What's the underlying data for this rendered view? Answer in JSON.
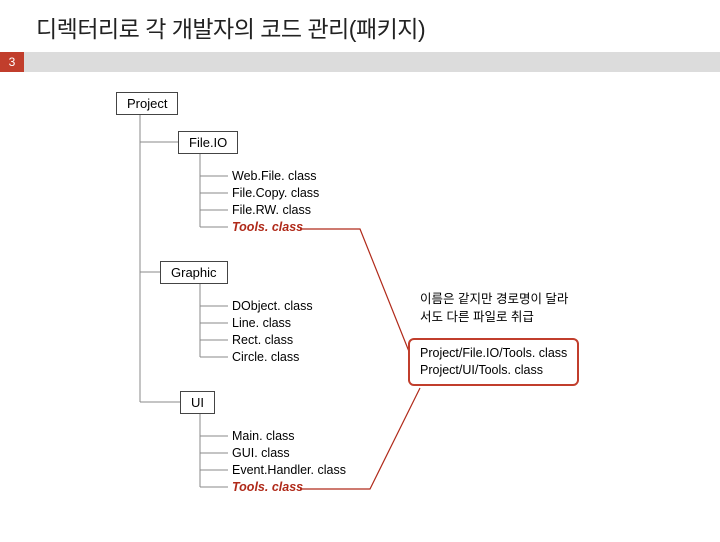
{
  "slide": {
    "title": "디렉터리로 각 개발자의 코드 관리(패키지)",
    "number": "3"
  },
  "tree": {
    "root": "Project",
    "folders": {
      "fileio": {
        "label": "File.IO",
        "files": {
          "f1": "Web.File. class",
          "f2": "File.Copy. class",
          "f3": "File.RW. class",
          "f4": "Tools. class"
        }
      },
      "graphic": {
        "label": "Graphic",
        "files": {
          "f1": "DObject. class",
          "f2": "Line. class",
          "f3": "Rect. class",
          "f4": "Circle. class"
        }
      },
      "ui": {
        "label": "UI",
        "files": {
          "f1": "Main. class",
          "f2": "GUI. class",
          "f3": "Event.Handler. class",
          "f4": "Tools. class"
        }
      }
    }
  },
  "note": {
    "line1": "이름은 같지만 경로명이 달라",
    "line2": "서도 다른 파일로 취급"
  },
  "paths": {
    "p1": "Project/File.IO/Tools. class",
    "p2": "Project/UI/Tools. class"
  }
}
